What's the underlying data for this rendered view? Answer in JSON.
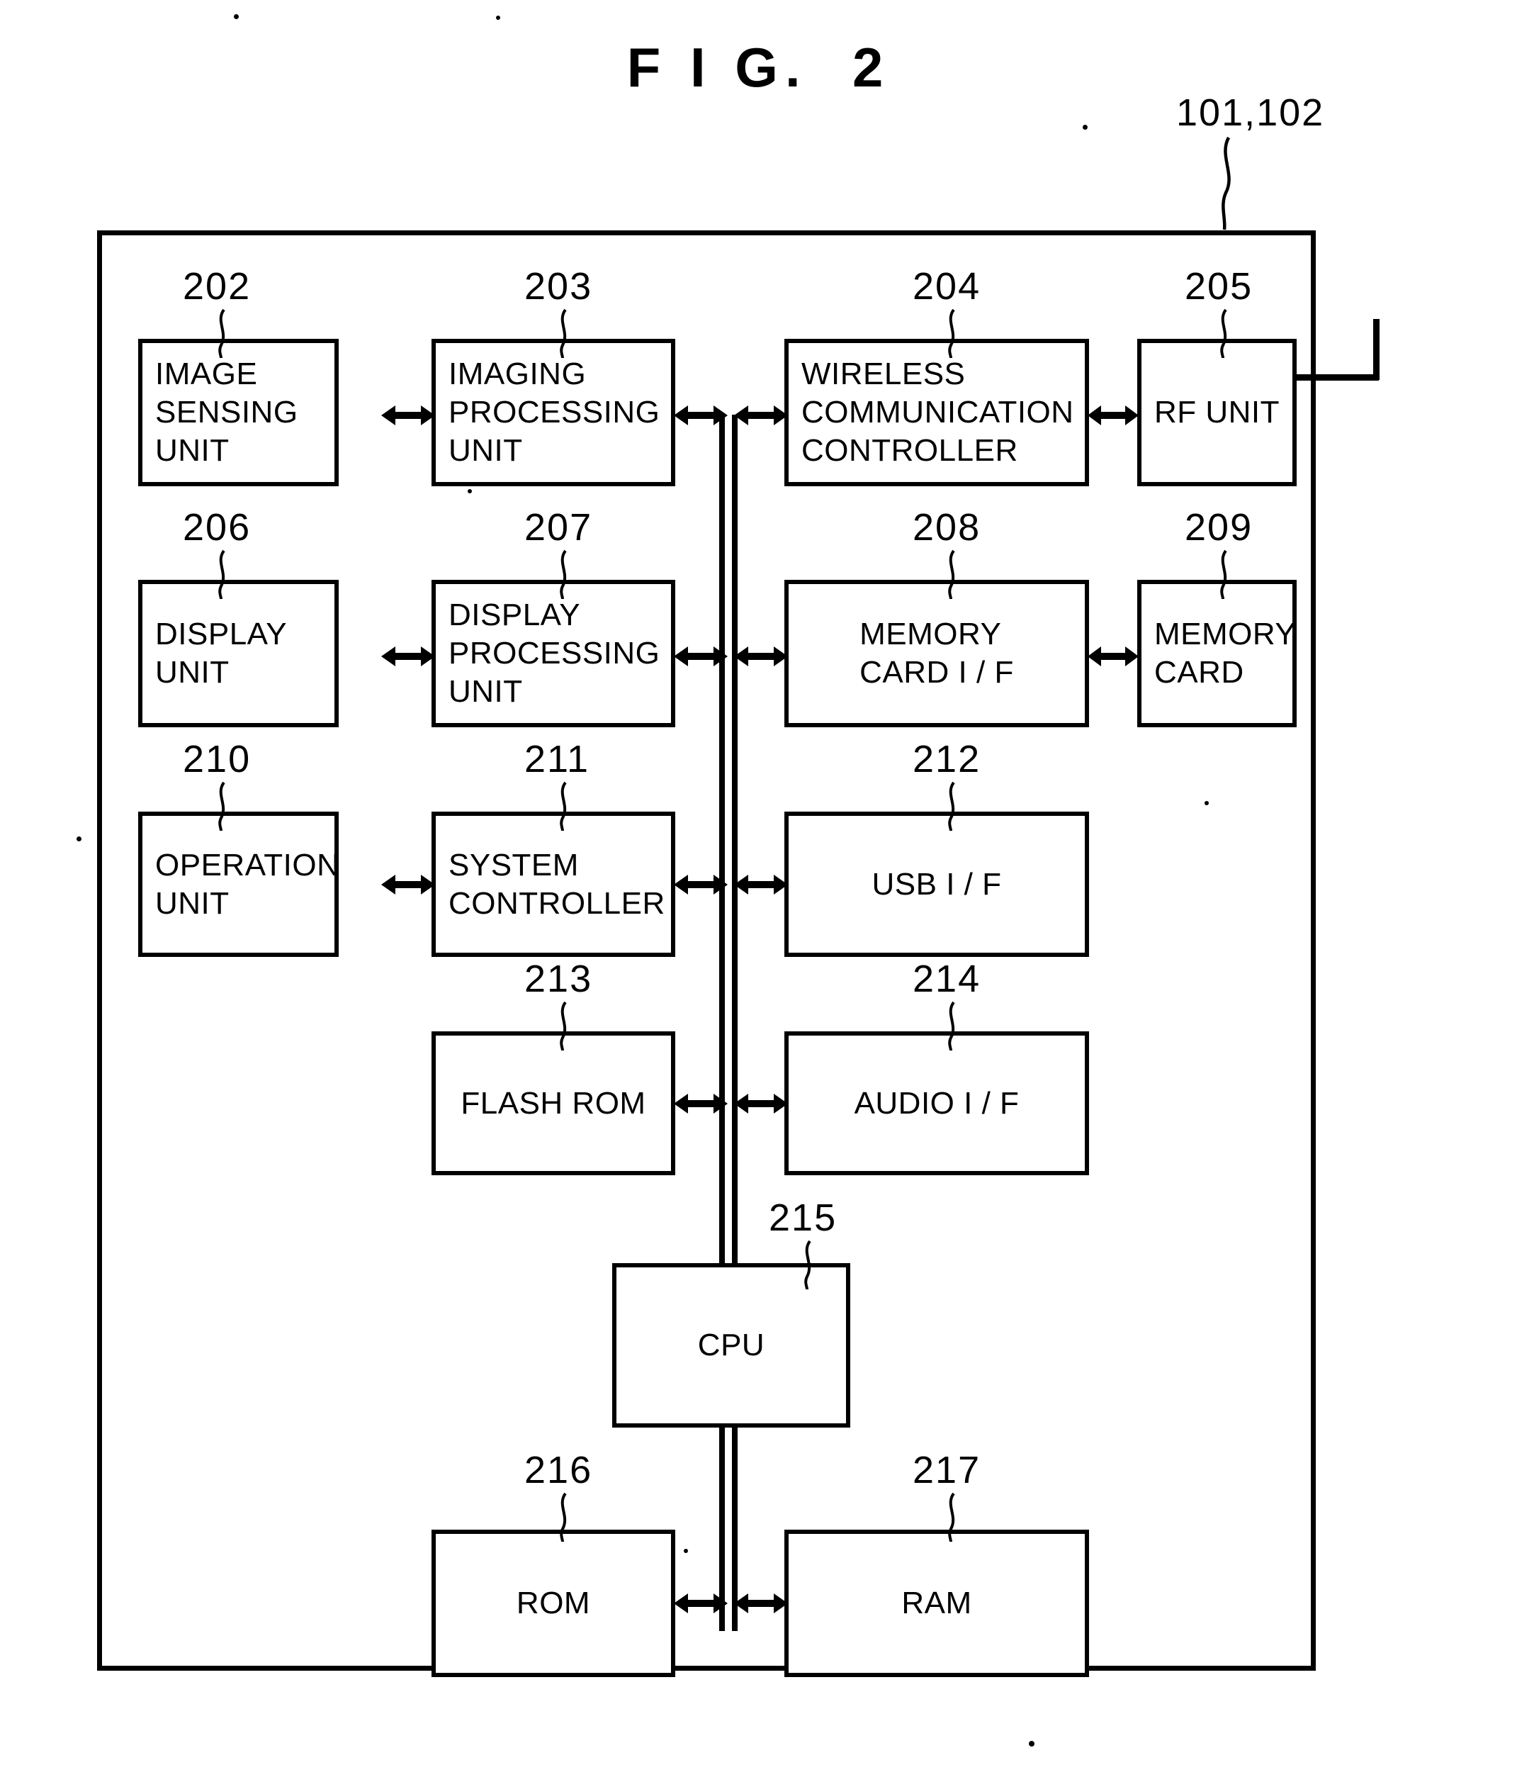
{
  "figure": {
    "title": "F I G.  2",
    "device_ref": "101,102"
  },
  "blocks": [
    {
      "id": "202",
      "ref": "202",
      "label": "IMAGE\nSENSING\nUNIT",
      "align": "left"
    },
    {
      "id": "203",
      "ref": "203",
      "label": "IMAGING\nPROCESSING\nUNIT",
      "align": "left"
    },
    {
      "id": "204",
      "ref": "204",
      "label": "WIRELESS\nCOMMUNICATION\nCONTROLLER",
      "align": "left"
    },
    {
      "id": "205",
      "ref": "205",
      "label": "RF UNIT",
      "align": "left"
    },
    {
      "id": "206",
      "ref": "206",
      "label": "DISPLAY\nUNIT",
      "align": "left"
    },
    {
      "id": "207",
      "ref": "207",
      "label": "DISPLAY\nPROCESSING\nUNIT",
      "align": "left"
    },
    {
      "id": "208",
      "ref": "208",
      "label": "MEMORY\nCARD I / F",
      "align": "center"
    },
    {
      "id": "209",
      "ref": "209",
      "label": "MEMORY\nCARD",
      "align": "left"
    },
    {
      "id": "210",
      "ref": "210",
      "label": "OPERATION\nUNIT",
      "align": "left"
    },
    {
      "id": "211",
      "ref": "211",
      "label": "SYSTEM\nCONTROLLER",
      "align": "left"
    },
    {
      "id": "212",
      "ref": "212",
      "label": "USB I / F",
      "align": "center"
    },
    {
      "id": "213",
      "ref": "213",
      "label": "FLASH ROM",
      "align": "center"
    },
    {
      "id": "214",
      "ref": "214",
      "label": "AUDIO I / F",
      "align": "center"
    },
    {
      "id": "215",
      "ref": "215",
      "label": "CPU",
      "align": "center"
    },
    {
      "id": "216",
      "ref": "216",
      "label": "ROM",
      "align": "center"
    },
    {
      "id": "217",
      "ref": "217",
      "label": "RAM",
      "align": "center"
    }
  ],
  "connections": [
    {
      "from": "202",
      "to": "203",
      "type": "bidirectional"
    },
    {
      "from": "203",
      "to": "bus",
      "type": "bidirectional"
    },
    {
      "from": "bus",
      "to": "204",
      "type": "bidirectional"
    },
    {
      "from": "204",
      "to": "205",
      "type": "bidirectional"
    },
    {
      "from": "206",
      "to": "207",
      "type": "bidirectional"
    },
    {
      "from": "207",
      "to": "bus",
      "type": "bidirectional"
    },
    {
      "from": "bus",
      "to": "208",
      "type": "bidirectional"
    },
    {
      "from": "208",
      "to": "209",
      "type": "bidirectional"
    },
    {
      "from": "210",
      "to": "211",
      "type": "bidirectional"
    },
    {
      "from": "211",
      "to": "bus",
      "type": "bidirectional"
    },
    {
      "from": "bus",
      "to": "212",
      "type": "bidirectional"
    },
    {
      "from": "213",
      "to": "bus",
      "type": "bidirectional"
    },
    {
      "from": "bus",
      "to": "214",
      "type": "bidirectional"
    },
    {
      "from": "216",
      "to": "bus",
      "type": "bidirectional"
    },
    {
      "from": "bus",
      "to": "217",
      "type": "bidirectional"
    }
  ],
  "colors": {
    "ink": "#000000",
    "paper": "#ffffff"
  }
}
